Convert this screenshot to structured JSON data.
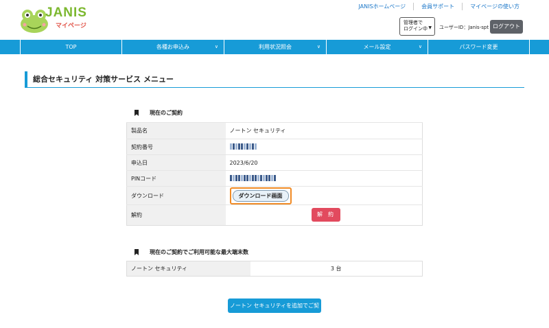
{
  "header": {
    "logo_text": "JANIS",
    "logo_sub": "マイページ",
    "top_links": [
      "JANISホームページ",
      "会員サポート",
      "マイページの使い方"
    ],
    "admin_select": {
      "line1": "管理者で",
      "line2": "ログイン中"
    },
    "user_id": "ユーザーID：Janis-spt",
    "logout_label": "ログアウト"
  },
  "nav": {
    "items": [
      {
        "label": "TOP",
        "has_dropdown": false
      },
      {
        "label": "各種お申込み",
        "has_dropdown": true
      },
      {
        "label": "利用状況照会",
        "has_dropdown": true
      },
      {
        "label": "メール設定",
        "has_dropdown": true
      },
      {
        "label": "パスワード変更",
        "has_dropdown": false
      }
    ]
  },
  "page_title": "総合セキュリティ 対策サービス メニュー",
  "contract": {
    "heading": "現在のご契約",
    "rows": [
      {
        "key": "製品名",
        "value": "ノートン セキュリティ"
      },
      {
        "key": "契約番号",
        "value": ""
      },
      {
        "key": "申込日",
        "value": "2023/6/20"
      },
      {
        "key": "PINコード",
        "value": ""
      },
      {
        "key": "ダウンロード",
        "value": ""
      },
      {
        "key": "解約",
        "value": ""
      }
    ],
    "download_label": "ダウンロード画面",
    "cancel_label": "解約"
  },
  "limit": {
    "heading": "現在のご契約でご利用可能な最大端末数",
    "product": "ノートン セキュリティ",
    "count": "3 台"
  },
  "add_contract_label": "ノートン セキュリティを追加でご契約",
  "colors": {
    "accent": "#179bd7",
    "logo_green": "#7cb82f",
    "danger": "#e24a5e",
    "highlight": "#f08a24"
  }
}
